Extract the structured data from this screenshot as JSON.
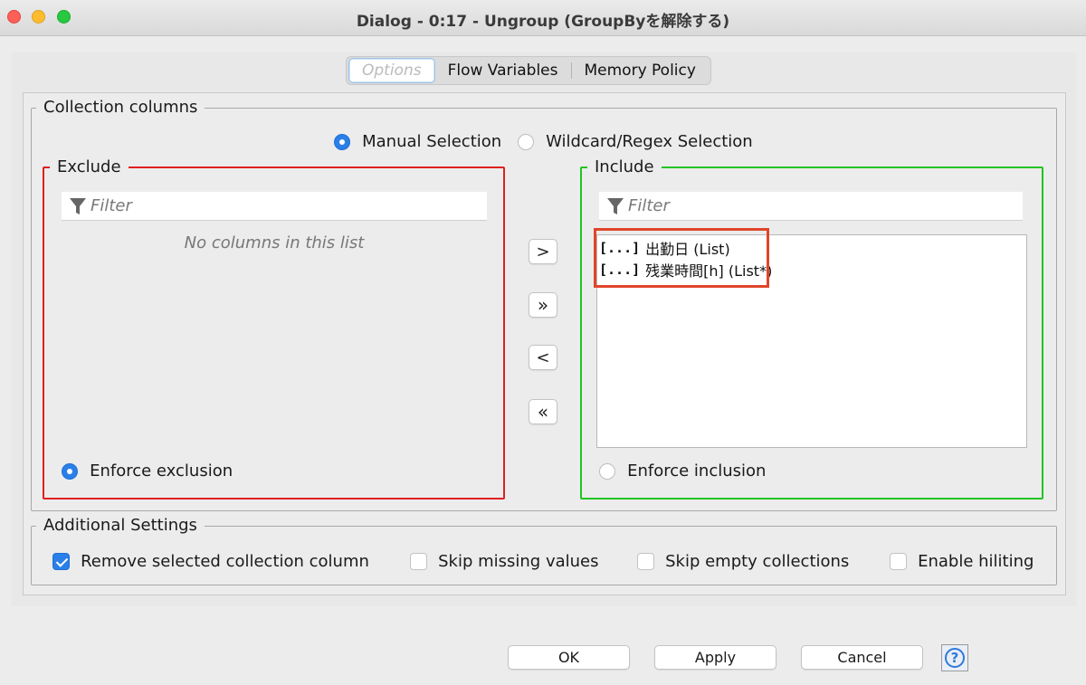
{
  "window": {
    "title": "Dialog - 0:17 - Ungroup (GroupByを解除する)"
  },
  "tabs": [
    {
      "label": "Options"
    },
    {
      "label": "Flow Variables"
    },
    {
      "label": "Memory Policy"
    }
  ],
  "collection": {
    "group_title": "Collection columns",
    "mode_manual": "Manual Selection",
    "mode_wildcard": "Wildcard/Regex Selection"
  },
  "exclude": {
    "title": "Exclude",
    "filter_placeholder": "Filter",
    "empty_text": "No columns in this list",
    "enforce_label": "Enforce exclusion"
  },
  "include": {
    "title": "Include",
    "filter_placeholder": "Filter",
    "items": [
      {
        "icon": "[...]",
        "label": "出勤日 (List)"
      },
      {
        "icon": "[...]",
        "label": "残業時間[h] (List*)"
      }
    ],
    "enforce_label": "Enforce inclusion"
  },
  "arrows": {
    "add": ">",
    "add_all": "»",
    "remove": "<",
    "remove_all": "«"
  },
  "additional": {
    "group_title": "Additional Settings",
    "remove_selected": "Remove selected collection column",
    "skip_missing": "Skip missing values",
    "skip_empty": "Skip empty collections",
    "enable_hiliting": "Enable hiliting"
  },
  "buttons": {
    "ok": "OK",
    "apply": "Apply",
    "cancel": "Cancel",
    "help": "?"
  },
  "colors": {
    "exclude_border": "#e02020",
    "include_border": "#22c422",
    "highlight_border": "#e0452a",
    "accent": "#2a7fe8"
  }
}
